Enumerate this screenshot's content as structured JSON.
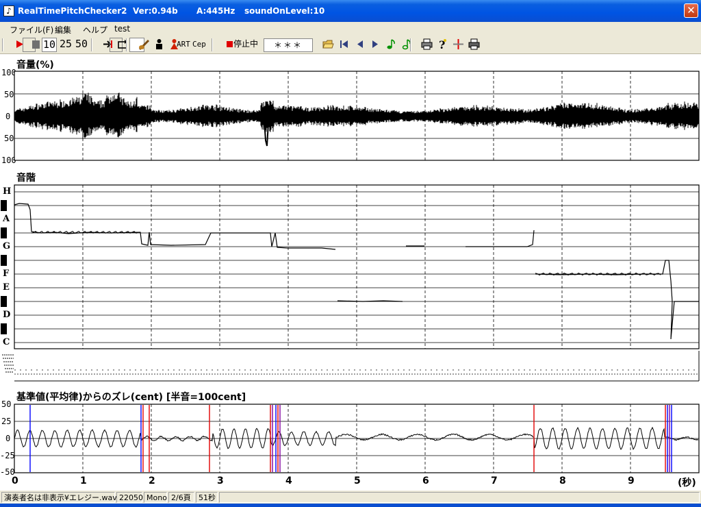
{
  "titlebar": {
    "app_name": "RealTimePitchChecker2",
    "version": "Ver:0.94b",
    "a_freq": "A:445Hz",
    "sound_on_level": "soundOnLevel:10",
    "close_glyph": "✕"
  },
  "menu": [
    "ファイル(F)",
    "編集",
    "ヘルプ",
    "test"
  ],
  "toolbar": {
    "num_10": "10",
    "num_25": "25",
    "num_50": "50",
    "art": "ART",
    "cep": "Cep",
    "status": "停止中",
    "note_display": "＊＊＊",
    "icons": [
      "play-icon",
      "stop-icon",
      "jump-end-icon",
      "loop-icon",
      "violin-icon",
      "person-black-icon",
      "person-red-icon",
      "record-icon",
      "folder-open-icon",
      "first-page-icon",
      "prev-page-icon",
      "next-page-icon",
      "note-green-icon",
      "note-green2-icon",
      "printer-icon",
      "help-icon",
      "marker-icon",
      "printer2-icon"
    ]
  },
  "volume_panel": {
    "title": "音量(%)",
    "y_labels": [
      "100",
      "50",
      "0",
      "50",
      "100"
    ]
  },
  "scale_panel": {
    "title": "音階",
    "notes": [
      "H",
      "A",
      "G",
      "F",
      "E",
      "D",
      "C"
    ]
  },
  "cent_panel": {
    "title": "基準値(平均律)からのズレ(cent) [半音=100cent]",
    "y_labels": [
      "50",
      "25",
      "0",
      "-25",
      "-50"
    ]
  },
  "x_axis": {
    "ticks": [
      "0",
      "1",
      "2",
      "3",
      "4",
      "5",
      "6",
      "7",
      "8",
      "9"
    ],
    "unit": "(秒)"
  },
  "statusbar": {
    "file": "演奏者名は非表示¥エレジー.wav",
    "rate": "22050",
    "channels": "Mono",
    "page": "2/6頁",
    "duration": "51秒"
  },
  "colors": {
    "titlebar": "#0054e3",
    "chrome": "#ece9d8",
    "marker_blue": "#0000ff",
    "marker_red": "#e00000",
    "marker_purple": "#8000a0"
  }
}
